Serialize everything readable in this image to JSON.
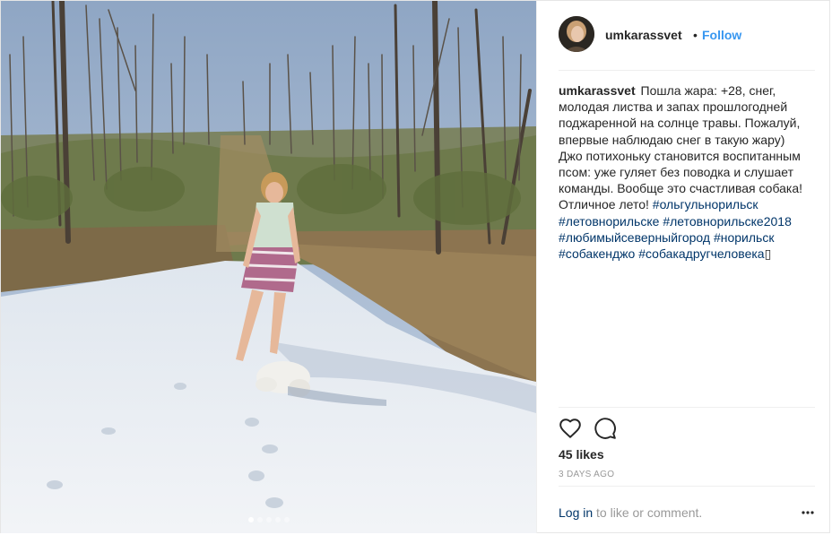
{
  "header": {
    "username": "umkarassvet",
    "separator": "•",
    "follow_label": "Follow"
  },
  "caption": {
    "username": "umkarassvet",
    "text": "Пошла жара: +28, снег, молодая листва и запах прошлогодней поджаренной на солнце травы. Пожалуй, впервые наблюдаю снег в такую жару) Джо потихоньку становится воспитанным псом: уже гуляет без поводка и слушает команды. Вообще это счастливая собака! Отличное лето!",
    "hashtags": [
      "#ольгульнорильск",
      "#летовнорильске",
      "#летовнорильске2018",
      "#любимыйсеверныйгород",
      "#норильск",
      "#собакенджо",
      "#собакадругчеловека"
    ],
    "trailing_glyph": "▯"
  },
  "actions": {
    "like_icon": "heart-icon",
    "comment_icon": "comment-icon"
  },
  "likes": "45 likes",
  "timestamp": "3 DAYS AGO",
  "footer": {
    "login_label": "Log in",
    "login_suffix": " to like or comment.",
    "more_icon": "more-options-icon"
  },
  "carousel": {
    "count": 5,
    "active_index": 0
  },
  "colors": {
    "link": "#003569",
    "follow": "#3897f0",
    "muted": "#999999",
    "text": "#262626"
  }
}
